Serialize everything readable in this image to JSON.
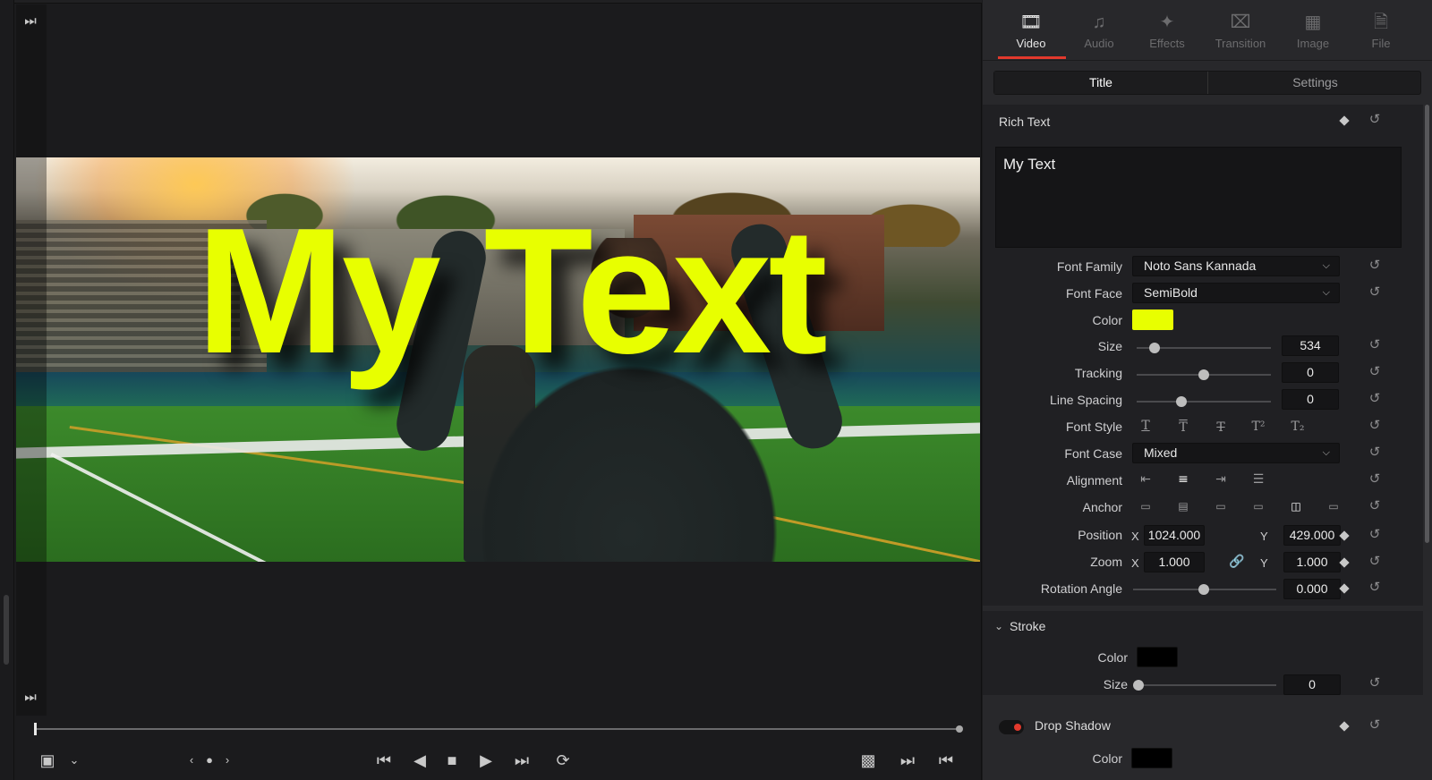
{
  "viewer": {
    "overlay_text": "My Text",
    "text_color": "#e8ff00"
  },
  "transport": {
    "icons": [
      "skip-to-end-icon",
      "crop-icon",
      "chevron-down-icon",
      "jog-left-icon",
      "jog-dot-icon",
      "jog-right-icon",
      "go-to-start-icon",
      "play-reverse-icon",
      "stop-icon",
      "play-icon",
      "go-to-end-icon",
      "loop-icon",
      "fullscreen-icon",
      "next-clip-icon",
      "prev-clip-icon"
    ]
  },
  "inspector": {
    "tabs": [
      {
        "label": "Video",
        "icon": "film-icon",
        "active": true
      },
      {
        "label": "Audio",
        "icon": "music-note-icon",
        "active": false
      },
      {
        "label": "Effects",
        "icon": "magic-wand-icon",
        "active": false
      },
      {
        "label": "Transition",
        "icon": "transition-icon",
        "active": false
      },
      {
        "label": "Image",
        "icon": "image-icon",
        "active": false
      },
      {
        "label": "File",
        "icon": "file-icon",
        "active": false
      }
    ],
    "subtabs": {
      "title": "Title",
      "settings": "Settings",
      "active": "Title"
    },
    "rich_text": {
      "header": "Rich Text",
      "value": "My Text"
    },
    "fields": {
      "font_family": {
        "label": "Font Family",
        "value": "Noto Sans Kannada"
      },
      "font_face": {
        "label": "Font Face",
        "value": "SemiBold"
      },
      "color": {
        "label": "Color",
        "value": "#e8ff00"
      },
      "size": {
        "label": "Size",
        "value": "534"
      },
      "tracking": {
        "label": "Tracking",
        "value": "0"
      },
      "line_spacing": {
        "label": "Line Spacing",
        "value": "0"
      },
      "font_style": {
        "label": "Font Style"
      },
      "font_case": {
        "label": "Font Case",
        "value": "Mixed"
      },
      "alignment": {
        "label": "Alignment"
      },
      "anchor": {
        "label": "Anchor"
      },
      "position": {
        "label": "Position",
        "x_label": "X",
        "x": "1024.000",
        "y_label": "Y",
        "y": "429.000"
      },
      "zoom": {
        "label": "Zoom",
        "x_label": "X",
        "x": "1.000",
        "y_label": "Y",
        "y": "1.000"
      },
      "rotation": {
        "label": "Rotation Angle",
        "value": "0.000"
      }
    },
    "stroke": {
      "header": "Stroke",
      "color_label": "Color",
      "color": "#000000",
      "size_label": "Size",
      "size": "0"
    },
    "drop_shadow": {
      "header": "Drop Shadow",
      "color_label": "Color",
      "color": "#000000",
      "enabled": true
    }
  }
}
